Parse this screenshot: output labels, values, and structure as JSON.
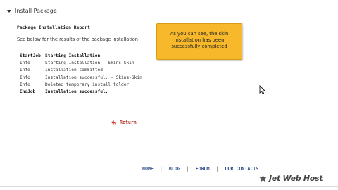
{
  "section": {
    "title": "Install Package"
  },
  "report": {
    "title": "Package Installation Report",
    "description": "See below for the results of the package installation"
  },
  "log": {
    "header": {
      "type": "StartJob",
      "message": "Starting Installation"
    },
    "rows": [
      {
        "type": "Info",
        "message": "Starting Installation - Skins-Skin"
      },
      {
        "type": "Info",
        "message": "Installation committed"
      },
      {
        "type": "Info",
        "message": "Installation successful. - Skins-Skin"
      },
      {
        "type": "Info",
        "message": "Deleted temporary install folder"
      }
    ],
    "footer": {
      "type": "EndJob",
      "message": "Installation successful."
    }
  },
  "callout": {
    "text": "As you can see, the skin installation has been successfully completed",
    "color": "#f7b92b"
  },
  "actions": {
    "return_label": "Return",
    "return_icon": "return-arrow-icon"
  },
  "footer_nav": {
    "links": [
      "HOME",
      "BLOG",
      "FORUM",
      "OUR CONTACTS"
    ],
    "separator": "|"
  },
  "brand": {
    "name": "Jet Web Host",
    "icon": "star-icon"
  },
  "colors": {
    "link": "#2d4f8a",
    "return": "#b23a2e",
    "callout": "#f7b92b"
  }
}
